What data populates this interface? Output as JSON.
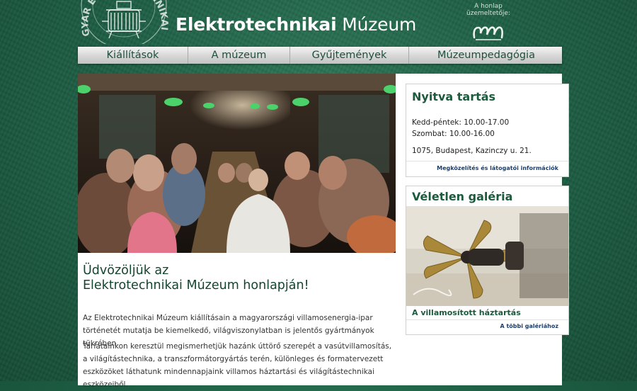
{
  "header": {
    "title_bold": "Elektrotechnikai",
    "title_regular": " Múzeum",
    "operator_label": "A honlap üzemeltetője:",
    "operator_logo": "emma",
    "seal_text": "GYAR ELEKTROTECHNIKAI MÚZ"
  },
  "nav": {
    "items": [
      {
        "label": "Kiállítások"
      },
      {
        "label": "A múzeum"
      },
      {
        "label": "Gyűjtemények"
      },
      {
        "label": "Múzeumpedagógia"
      }
    ]
  },
  "main": {
    "welcome_line1": "Üdvözöljük az",
    "welcome_line2": "Elektrotechnikai Múzeum honlapján!",
    "paragraph1": "Az Elektrotechnikai Múzeum kiállításain a magyarországi villamosenergia-ipar történetét mutatja be kiemelkedő, világviszonylatban is jelentős gyártmányok tükrében.",
    "paragraph2": "Tárlatainkon keresztül megismerhetjük hazánk úttörő szerepét a vasútvillamosítás, a világítástechnika, a transzformátorgyártás terén, különleges és formatervezett eszközöket láthatunk mindennapjaink villamos háztartási és világítástechnikai eszközeiből."
  },
  "opening": {
    "title": "Nyitva tartás",
    "line1": "Kedd-péntek: 10.00-17.00",
    "line2": "Szombat: 10.00-16.00",
    "address": "1075, Budapest, Kazinczy u. 21.",
    "link": "Megközelítés és látogatói információk"
  },
  "gallery": {
    "title": "Véletlen galéria",
    "caption": "A villamosított háztartás",
    "link": "A többi galériához"
  },
  "colors": {
    "background": "#1f6146",
    "accent_text": "#1c5a3d",
    "link": "#1c3f6e"
  }
}
